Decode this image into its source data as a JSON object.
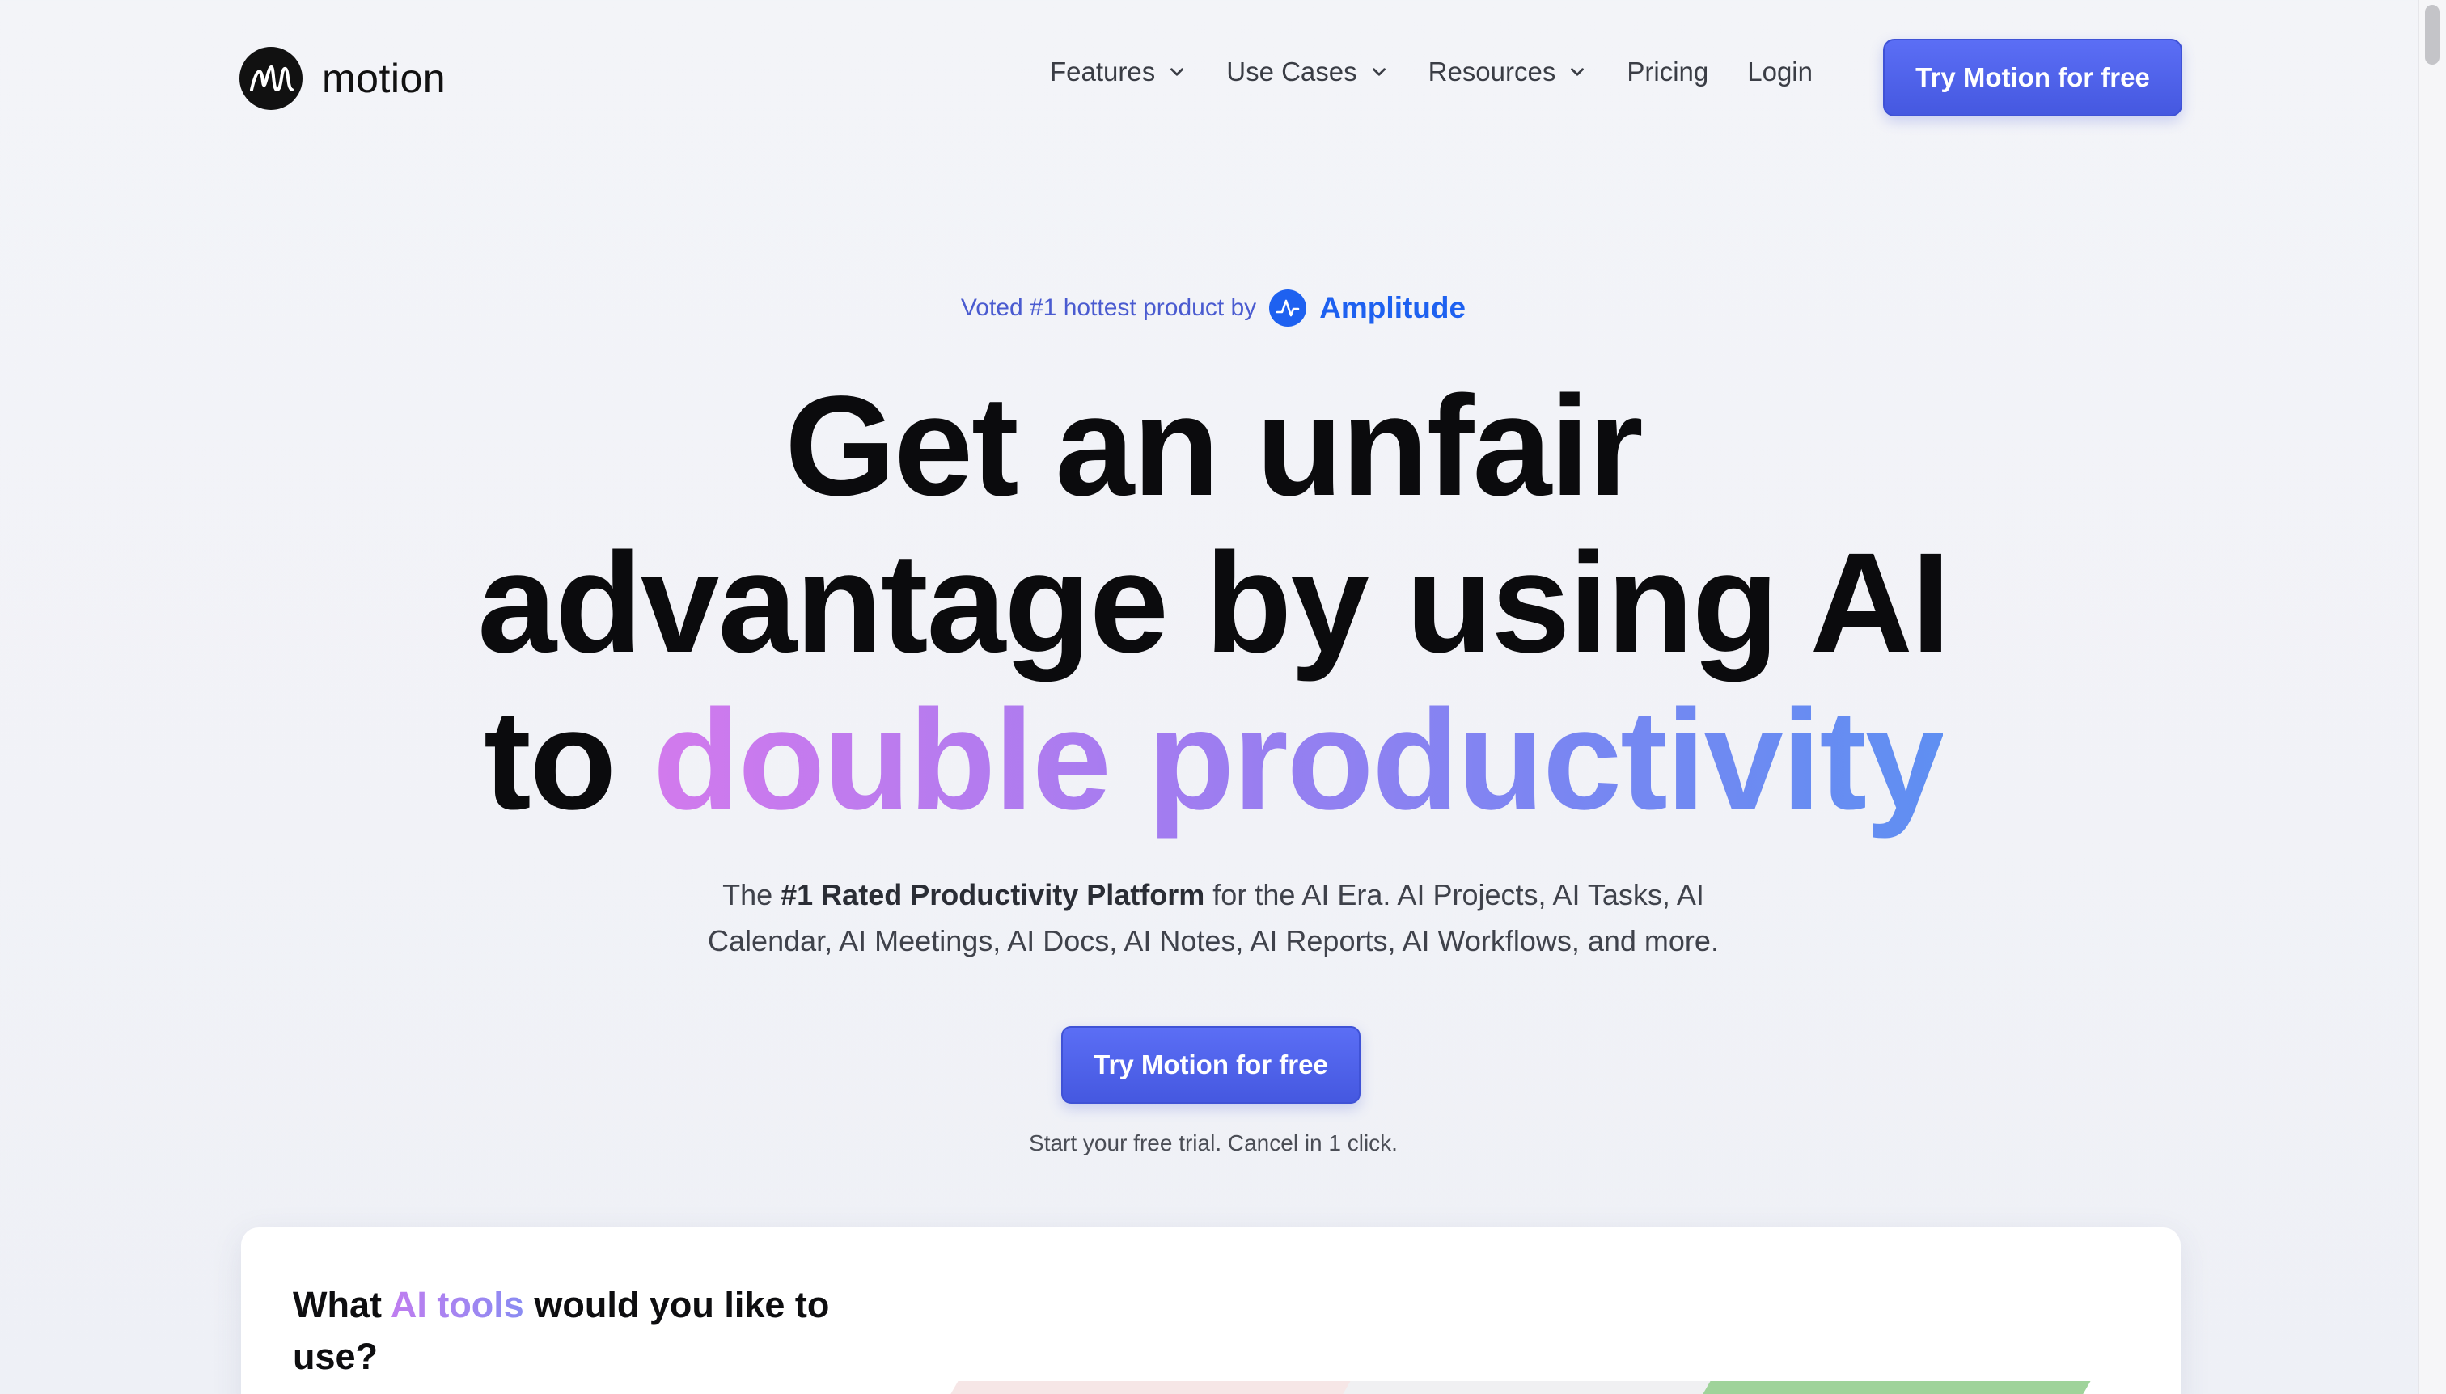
{
  "brand": {
    "name": "motion"
  },
  "nav": {
    "items": [
      {
        "label": "Features",
        "has_menu": true
      },
      {
        "label": "Use Cases",
        "has_menu": true
      },
      {
        "label": "Resources",
        "has_menu": true
      },
      {
        "label": "Pricing",
        "has_menu": false
      },
      {
        "label": "Login",
        "has_menu": false
      }
    ],
    "cta_label": "Try Motion for free"
  },
  "hero": {
    "voted_text": "Voted #1 hottest product by",
    "voted_brand": "Amplitude",
    "headline_line1": "Get an unfair",
    "headline_line2": "advantage by using AI",
    "headline_line3_plain": "to",
    "headline_line3_accent": "double productivity",
    "sub_prefix": "The",
    "sub_bold": "#1 Rated Productivity Platform",
    "sub_line1_rest": "for the AI Era. AI Projects, AI Tasks, AI",
    "sub_line2": "Calendar, AI Meetings, AI Docs, AI Notes, AI Reports, AI Workflows, and more.",
    "cta_label": "Try Motion for free",
    "trial_note": "Start your free trial. Cancel in 1 click."
  },
  "tools_card": {
    "title_prefix": "What",
    "title_accent": "AI tools",
    "title_suffix": "would you like to use?"
  },
  "colors": {
    "accent": "#4a5de6",
    "amplitude_blue": "#1e61f0",
    "gradient_start": "#d27aed",
    "gradient_end": "#5f8ff2"
  }
}
